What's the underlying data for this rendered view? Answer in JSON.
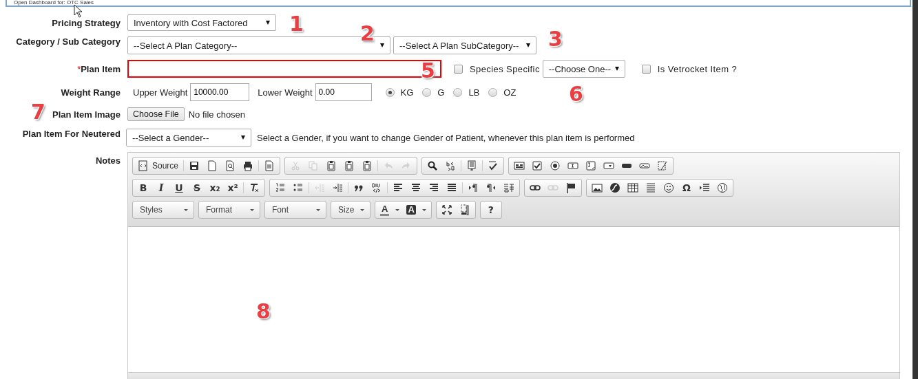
{
  "top_banner": {
    "text": "Open Dashboard for: OTC Sales"
  },
  "form": {
    "pricing_strategy": {
      "label": "Pricing Strategy",
      "value": "Inventory with Cost Factored"
    },
    "category": {
      "label": "Category / Sub Category",
      "category_value": "--Select A Plan Category--",
      "subcategory_value": "--Select A Plan SubCategory--"
    },
    "plan_item": {
      "required_mark": "*",
      "label": "Plan Item",
      "invalid": true
    },
    "species_specific": {
      "label": "Species Specific",
      "checked": false
    },
    "species_select": {
      "value": "--Choose One--"
    },
    "is_vetrocket": {
      "label": "Is Vetrocket Item ?",
      "checked": false
    },
    "weight_range": {
      "label": "Weight Range",
      "upper_label": "Upper Weight",
      "upper_value": "10000.00",
      "lower_label": "Lower Weight",
      "lower_value": "0.00",
      "units": [
        {
          "label": "KG",
          "selected": true
        },
        {
          "label": "G",
          "selected": false
        },
        {
          "label": "LB",
          "selected": false
        },
        {
          "label": "OZ",
          "selected": false
        }
      ]
    },
    "plan_item_image": {
      "label": "Plan Item Image",
      "button": "Choose File",
      "status": "No file chosen"
    },
    "neutered": {
      "label": "Plan Item For Neutered",
      "value": "--Select a Gender--",
      "hint": "Select a Gender, if you want to change Gender of Patient, whenever this plan item is performed"
    },
    "notes": {
      "label": "Notes",
      "toolbar": [
        [
          [
            {
              "kind": "source",
              "label": "Source",
              "disabled": false
            },
            {
              "kind": "separator"
            },
            {
              "kind": "save",
              "disabled": false
            },
            {
              "kind": "newpage",
              "disabled": false
            },
            {
              "kind": "preview",
              "disabled": false
            },
            {
              "kind": "print",
              "disabled": false
            },
            {
              "kind": "separator"
            },
            {
              "kind": "templates",
              "disabled": false
            }
          ],
          [
            {
              "kind": "cut",
              "disabled": true
            },
            {
              "kind": "copy",
              "disabled": true
            },
            {
              "kind": "paste",
              "disabled": false
            },
            {
              "kind": "pastetext",
              "disabled": false
            },
            {
              "kind": "pasteword",
              "disabled": false
            },
            {
              "kind": "separator"
            },
            {
              "kind": "undo",
              "disabled": true
            },
            {
              "kind": "redo",
              "disabled": true
            }
          ],
          [
            {
              "kind": "find",
              "disabled": false
            },
            {
              "kind": "replace",
              "disabled": false
            },
            {
              "kind": "separator"
            },
            {
              "kind": "selectall",
              "disabled": false
            },
            {
              "kind": "separator"
            },
            {
              "kind": "spell",
              "disabled": false
            }
          ],
          [
            {
              "kind": "form",
              "disabled": false
            },
            {
              "kind": "checkbox",
              "disabled": false
            },
            {
              "kind": "radio",
              "disabled": false
            },
            {
              "kind": "textfield",
              "disabled": false
            },
            {
              "kind": "textarea",
              "disabled": false
            },
            {
              "kind": "select",
              "disabled": false
            },
            {
              "kind": "button",
              "disabled": false
            },
            {
              "kind": "imagebutton",
              "disabled": false
            },
            {
              "kind": "hidden",
              "disabled": false
            }
          ]
        ],
        [
          [
            {
              "kind": "bold",
              "label": "B",
              "disabled": false
            },
            {
              "kind": "italic",
              "label": "I",
              "disabled": false
            },
            {
              "kind": "underline",
              "label": "U",
              "disabled": false
            },
            {
              "kind": "strike",
              "label": "S",
              "disabled": false
            },
            {
              "kind": "subscript",
              "label": "x₂",
              "disabled": false
            },
            {
              "kind": "superscript",
              "label": "x²",
              "disabled": false
            },
            {
              "kind": "separator"
            },
            {
              "kind": "removeformat",
              "disabled": false
            }
          ],
          [
            {
              "kind": "ol",
              "disabled": false
            },
            {
              "kind": "ul",
              "disabled": false
            },
            {
              "kind": "separator"
            },
            {
              "kind": "outdent",
              "disabled": true
            },
            {
              "kind": "indent",
              "disabled": false
            },
            {
              "kind": "separator"
            },
            {
              "kind": "quote",
              "disabled": false
            },
            {
              "kind": "div",
              "disabled": false
            },
            {
              "kind": "separator"
            },
            {
              "kind": "left",
              "disabled": false
            },
            {
              "kind": "center",
              "disabled": false
            },
            {
              "kind": "right",
              "disabled": false
            },
            {
              "kind": "justify",
              "disabled": false
            },
            {
              "kind": "separator"
            },
            {
              "kind": "ltr",
              "disabled": false
            },
            {
              "kind": "rtl",
              "disabled": false
            },
            {
              "kind": "language",
              "disabled": false
            }
          ],
          [
            {
              "kind": "link",
              "disabled": false
            },
            {
              "kind": "unlink",
              "disabled": true
            },
            {
              "kind": "anchor",
              "disabled": false
            }
          ],
          [
            {
              "kind": "image",
              "disabled": false
            },
            {
              "kind": "flash",
              "disabled": false
            },
            {
              "kind": "table",
              "disabled": false
            },
            {
              "kind": "rule",
              "disabled": false
            },
            {
              "kind": "smiley",
              "disabled": false
            },
            {
              "kind": "symbol",
              "label": "Ω",
              "disabled": false
            },
            {
              "kind": "iframe",
              "disabled": false
            },
            {
              "kind": "globe",
              "disabled": false
            }
          ]
        ],
        [
          [
            {
              "kind": "combo",
              "label": "Styles"
            },
            {
              "kind": "combo",
              "label": "Format"
            },
            {
              "kind": "combo",
              "label": "Font"
            },
            {
              "kind": "combo",
              "label": "Size"
            }
          ],
          [
            {
              "kind": "textcolor",
              "label": "A",
              "disabled": false
            },
            {
              "kind": "bgcolor",
              "label": "A",
              "disabled": false
            }
          ],
          [
            {
              "kind": "maximize",
              "disabled": false
            },
            {
              "kind": "showblocks",
              "disabled": false
            }
          ],
          [
            {
              "kind": "help",
              "label": "?",
              "disabled": false
            }
          ]
        ]
      ]
    }
  },
  "annotations": [
    "1",
    "2",
    "3",
    "5",
    "6",
    "7",
    "8"
  ]
}
